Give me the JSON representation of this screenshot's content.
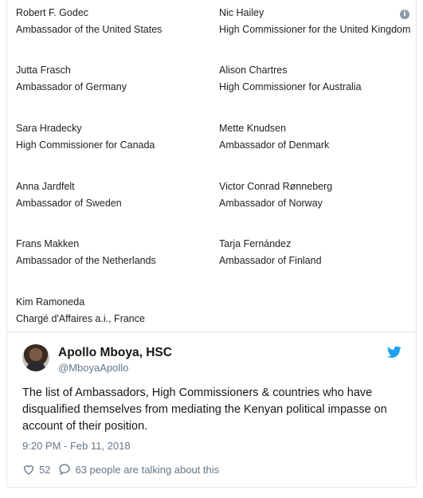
{
  "officials": [
    {
      "name": "Robert F. Godec",
      "title": "Ambassador of the United States"
    },
    {
      "name": "Nic Hailey",
      "title": "High Commissioner for the United Kingdom"
    },
    {
      "name": "Jutta Frasch",
      "title": "Ambassador of Germany"
    },
    {
      "name": "Alison Chartres",
      "title": "High Commissioner for Australia"
    },
    {
      "name": "Sara Hradecky",
      "title": "High Commissioner for Canada"
    },
    {
      "name": "Mette Knudsen",
      "title": "Ambassador of Denmark"
    },
    {
      "name": "Anna Jardfelt",
      "title": "Ambassador of Sweden"
    },
    {
      "name": "Victor Conrad Rønneberg",
      "title": "Ambassador of Norway"
    },
    {
      "name": "Frans Makken",
      "title": "Ambassador of the Netherlands"
    },
    {
      "name": "Tarja Fernández",
      "title": "Ambassador of Finland"
    },
    {
      "name": "Kim Ramoneda",
      "title": "Chargé d'Affaires a.i., France"
    }
  ],
  "tweet": {
    "author_name": "Apollo Mboya, HSC",
    "author_handle": "@MboyaApollo",
    "text": "The list of Ambassadors, High Commissioners & countries who have disqualified themselves from mediating the Kenyan political impasse on account of their position.",
    "timestamp": "9:20 PM - Feb 11, 2018",
    "likes": "52",
    "talking": "63 people are talking about this"
  },
  "icons": {
    "info": "info-icon",
    "bird": "twitter-bird-icon",
    "heart": "heart-icon",
    "comment": "comment-icon"
  },
  "colors": {
    "twitter_blue": "#1da1f2",
    "muted_text": "#657786",
    "border": "#e1e8ed"
  }
}
